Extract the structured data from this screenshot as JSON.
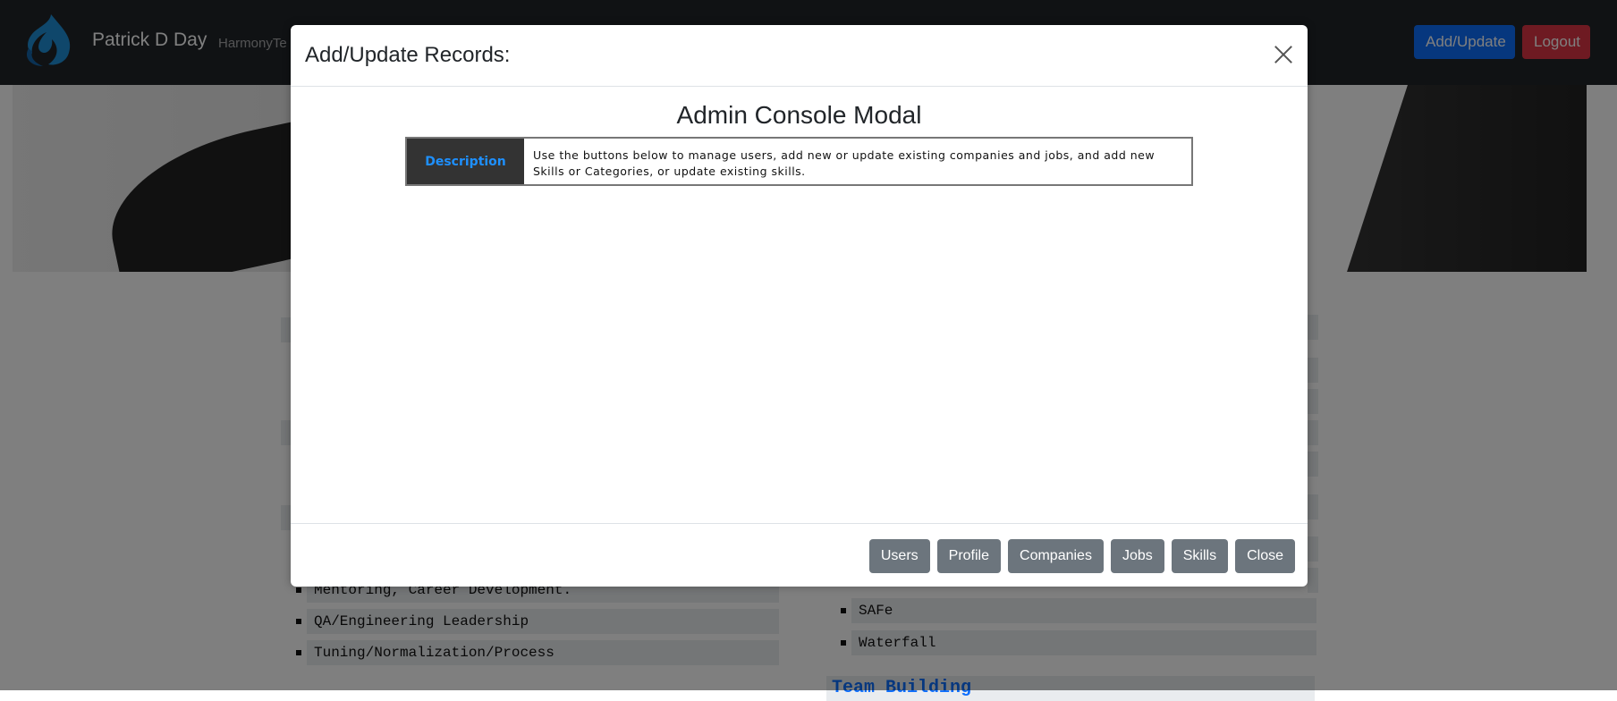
{
  "navbar": {
    "brand": "Patrick D Day",
    "nav_link": "HarmonyTe",
    "add_update_label": "Add/Update",
    "logout_label": "Logout"
  },
  "background_lists": {
    "left_items": [
      "Mentoring, Career Development.",
      "QA/Engineering Leadership",
      "Tuning/Normalization/Process"
    ],
    "right_items": [
      "SAFe",
      "Waterfall"
    ],
    "right_heading": "Team Building"
  },
  "modal": {
    "title": "Add/Update Records:",
    "console_title": "Admin Console Modal",
    "description_label": "Description",
    "description_text": "Use the buttons below to manage users, add new or update existing companies and jobs, and add new Skills or Categories, or update existing skills.",
    "buttons": {
      "users": "Users",
      "profile": "Profile",
      "companies": "Companies",
      "jobs": "Jobs",
      "skills": "Skills",
      "close": "Close"
    }
  },
  "colors": {
    "navbar_bg": "#212529",
    "primary": "#0d6efd",
    "danger": "#dc3545",
    "secondary": "#6c757d"
  }
}
